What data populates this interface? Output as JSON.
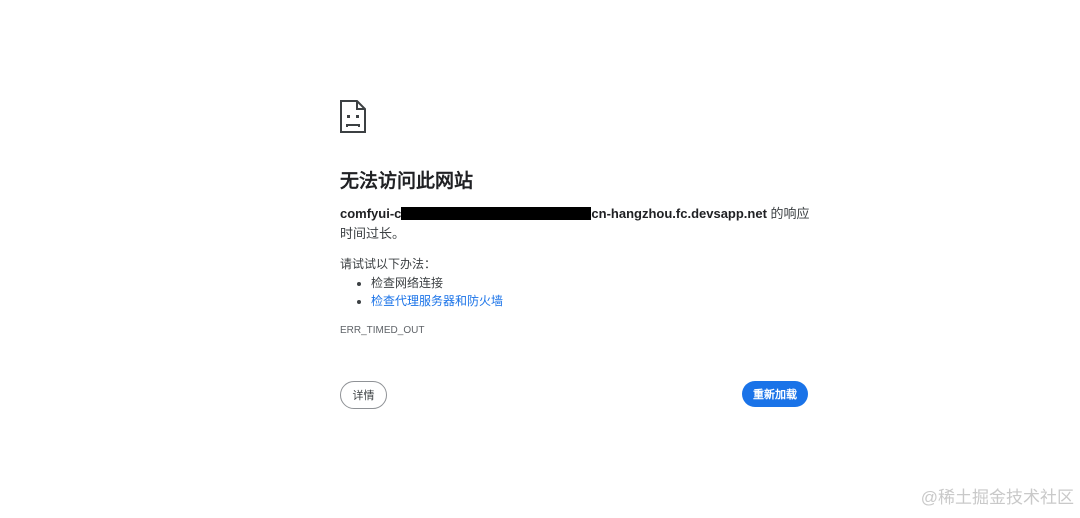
{
  "heading": "无法访问此网站",
  "message": {
    "host_prefix": "comfyui-c",
    "host_suffix": "cn-hangzhou.fc.devsapp.net",
    "text": " 的响应时间过长。"
  },
  "suggestions": {
    "intro": "请试试以下办法：",
    "items": [
      {
        "label": "检查网络连接"
      },
      {
        "label": "检查代理服务器和防火墙"
      }
    ]
  },
  "error_code": "ERR_TIMED_OUT",
  "buttons": {
    "details": "详情",
    "reload": "重新加载"
  },
  "icons": {
    "error": "sad-page-icon"
  },
  "watermark": "@稀土掘金技术社区",
  "colors": {
    "link": "#1a73e8",
    "primary": "#1a73e8",
    "text": "#202124",
    "secondary": "#5f6368"
  }
}
